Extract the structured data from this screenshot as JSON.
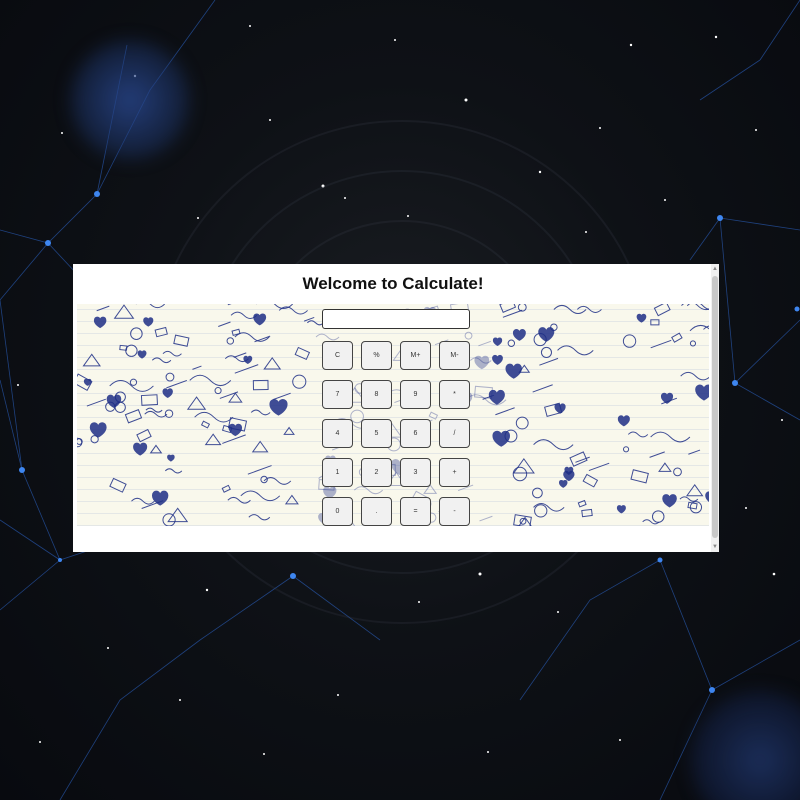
{
  "page": {
    "title": "Welcome to Calculate!"
  },
  "calculator": {
    "display_value": "",
    "keys": [
      [
        "C",
        "%",
        "M+",
        "M-"
      ],
      [
        "7",
        "8",
        "9",
        "*"
      ],
      [
        "4",
        "5",
        "6",
        "/"
      ],
      [
        "1",
        "2",
        "3",
        "+"
      ],
      [
        "0",
        ".",
        "=",
        "-"
      ]
    ]
  },
  "colors": {
    "doodle_ink": "#1f2f86",
    "paper": "#f9f8ec",
    "background": "#0c0f14",
    "network_line": "#2f6bd6",
    "network_node": "#3e86f0"
  },
  "scrollbar": {
    "up_icon": "scroll-up-arrow-icon",
    "down_icon": "scroll-down-arrow-icon"
  }
}
